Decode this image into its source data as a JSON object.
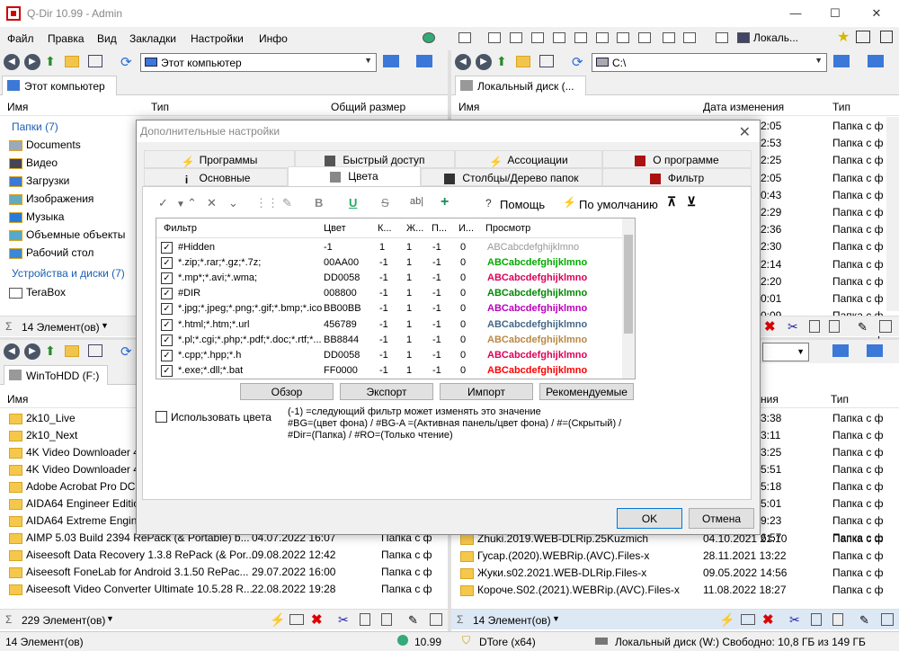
{
  "window": {
    "title": "Q-Dir 10.99 - Admin",
    "minimize": "—",
    "maximize": "☐",
    "close": "✕"
  },
  "menu": [
    "Файл",
    "Правка",
    "Вид",
    "Закладки",
    "Настройки",
    "Инфо"
  ],
  "toolbar_right": {
    "locale_label": "Локаль..."
  },
  "pane_tl": {
    "address": "Этот компьютер",
    "tab": "Этот компьютер",
    "columns": [
      "Имя",
      "Тип",
      "Общий размер"
    ],
    "group1": "Папки (7)",
    "items": [
      "Documents",
      "Видео",
      "Загрузки",
      "Изображения",
      "Музыка",
      "Объемные объекты",
      "Рабочий стол"
    ],
    "group2": "Устройства и диски (7)",
    "drive_item": "TeraBox",
    "status": "14 Элемент(ов)"
  },
  "pane_tr": {
    "address": "C:\\",
    "tab": "Локальный диск (...",
    "columns": [
      "Имя",
      "Дата изменения",
      "Тип"
    ],
    "times": [
      "2:05",
      "2:53",
      "2:25",
      "2:05",
      "0:43",
      "2:29",
      "2:36",
      "2:30",
      "2:14",
      "2:20",
      "0:01",
      "0:09",
      "2:00"
    ],
    "type_value": "Папка с ф"
  },
  "pane_bl": {
    "tab": "WinToHDD (F:)",
    "columns": [
      "Имя"
    ],
    "items": [
      {
        "name": "2k10_Live",
        "date": "",
        "type": ""
      },
      {
        "name": "2k10_Next",
        "date": "",
        "type": ""
      },
      {
        "name": "4K Video Downloader 4.",
        "date": "",
        "type": ""
      },
      {
        "name": "4K Video Downloader 4.",
        "date": "",
        "type": ""
      },
      {
        "name": "Adobe Acrobat Pro DC",
        "date": "",
        "type": ""
      },
      {
        "name": "AIDA64 Engineer Edition",
        "date": "",
        "type": ""
      },
      {
        "name": "AIDA64 Extreme Engine",
        "date": "",
        "type": ""
      },
      {
        "name": "AIMP 5.03 Build 2394 RePack (& Portable) b...",
        "date": "04.07.2022 16:07",
        "type": "Папка с ф"
      },
      {
        "name": "Aiseesoft Data Recovery 1.3.8 RePack (& Por...",
        "date": "09.08.2022 12:42",
        "type": "Папка с ф"
      },
      {
        "name": "Aiseesoft FoneLab for Android 3.1.50 RePac...",
        "date": "29.07.2022 16:00",
        "type": "Папка с ф"
      },
      {
        "name": "Aiseesoft Video Converter Ultimate 10.5.28 R...",
        "date": "22.08.2022 19:28",
        "type": "Папка с ф"
      }
    ],
    "status": "229 Элемент(ов)"
  },
  "pane_br": {
    "columns": [
      "ния",
      "Тип"
    ],
    "times": [
      "3:38",
      "3:11",
      "3:25",
      "5:51",
      "5:18",
      "5:01",
      "9:23",
      "6:57"
    ],
    "type_value": "Папка с ф",
    "items": [
      {
        "name": "Zhuki.2019.WEB-DLRip.25Kuzmich",
        "date": "04.10.2021 21:10",
        "type": "Папка с ф"
      },
      {
        "name": "Гусар.(2020).WEBRip.(AVC).Files-x",
        "date": "28.11.2021 13:22",
        "type": "Папка с ф"
      },
      {
        "name": "Жуки.s02.2021.WEB-DLRip.Files-x",
        "date": "09.05.2022 14:56",
        "type": "Папка с ф"
      },
      {
        "name": "Короче.S02.(2021).WEBRip.(AVC).Files-x",
        "date": "11.08.2022 18:27",
        "type": "Папка с ф"
      }
    ],
    "status": "14 Элемент(ов)"
  },
  "bottom_status": {
    "items": "14 Элемент(ов)",
    "version": "10.99",
    "app": "DTore (x64)",
    "disk": "Локальный диск (W:) Свободно: 10,8 ГБ из 149 ГБ"
  },
  "dialog": {
    "title": "Дополнительные настройки",
    "tabs_row1": [
      "Программы",
      "Быстрый доступ",
      "Ассоциации",
      "О программе"
    ],
    "tabs_row2": [
      "Основные",
      "Цвета",
      "Столбцы/Дерево папок",
      "Фильтр"
    ],
    "help_label": "Помощь",
    "default_label": "По умолчанию",
    "grid_columns": [
      "Фильтр",
      "Цвет",
      "К...",
      "Ж...",
      "П...",
      "И...",
      "Просмотр"
    ],
    "preview_text": "ABCabcdefghijklmno",
    "rows": [
      {
        "filter": "#Hidden",
        "color": "-1",
        "k": "1",
        "zh": "1",
        "p": "-1",
        "i": "0",
        "preview_color": "#999999",
        "bold": false
      },
      {
        "filter": "*.zip;*.rar;*.gz;*.7z;",
        "color": "00AA00",
        "k": "-1",
        "zh": "1",
        "p": "-1",
        "i": "0",
        "preview_color": "#00AA00",
        "bold": true
      },
      {
        "filter": "*.mp*;*.avi;*.wma;",
        "color": "DD0058",
        "k": "-1",
        "zh": "1",
        "p": "-1",
        "i": "0",
        "preview_color": "#DD0058",
        "bold": true
      },
      {
        "filter": "#DIR",
        "color": "008800",
        "k": "-1",
        "zh": "1",
        "p": "-1",
        "i": "0",
        "preview_color": "#008800",
        "bold": true
      },
      {
        "filter": "*.jpg;*.jpeg;*.png;*.gif;*.bmp;*.ico",
        "color": "BB00BB",
        "k": "-1",
        "zh": "1",
        "p": "-1",
        "i": "0",
        "preview_color": "#BB00BB",
        "bold": true
      },
      {
        "filter": "*.html;*.htm;*.url",
        "color": "456789",
        "k": "-1",
        "zh": "1",
        "p": "-1",
        "i": "0",
        "preview_color": "#456789",
        "bold": true
      },
      {
        "filter": "*.pl;*.cgi;*.php;*.pdf;*.doc;*.rtf;*...",
        "color": "BB8844",
        "k": "-1",
        "zh": "1",
        "p": "-1",
        "i": "0",
        "preview_color": "#BB8844",
        "bold": true
      },
      {
        "filter": "*.cpp;*.hpp;*.h",
        "color": "DD0058",
        "k": "-1",
        "zh": "1",
        "p": "-1",
        "i": "0",
        "preview_color": "#DD0058",
        "bold": true
      },
      {
        "filter": "*.exe;*.dll;*.bat",
        "color": "FF0000",
        "k": "-1",
        "zh": "1",
        "p": "-1",
        "i": "0",
        "preview_color": "#FF0000",
        "bold": true
      }
    ],
    "buttons": [
      "Обзор",
      "Экспорт",
      "Импорт",
      "Рекомендуемые"
    ],
    "use_colors_label": "Использовать цвета",
    "note_lines": [
      "(-1) =следующий фильтр может изменять это значение",
      "#BG=(цвет фона) / #BG-A =(Активная панель/цвет фона) / #=(Скрытый) /",
      "#Dir=(Папка) / #RO=(Только чтение)"
    ],
    "ok_label": "OK",
    "cancel_label": "Отмена"
  }
}
